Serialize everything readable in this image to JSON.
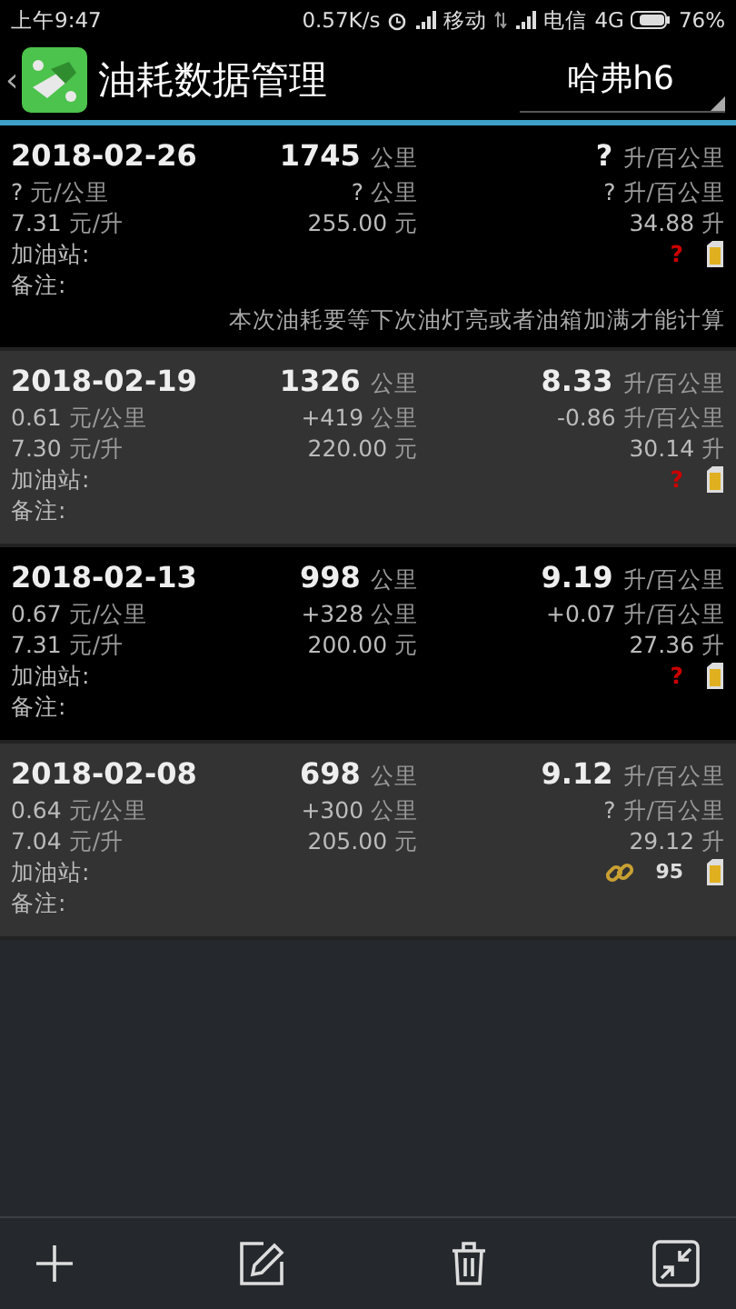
{
  "status_bar": {
    "time": "上午9:47",
    "speed": "0.57K/s",
    "carrier_1": "移动",
    "carrier_2": "电信",
    "network": "4G",
    "battery": "76%"
  },
  "header": {
    "title": "油耗数据管理",
    "back": "‹",
    "vehicle": "哈弗h6"
  },
  "records": [
    {
      "date": "2018-02-26",
      "odometer": {
        "value": "1745",
        "unit": "公里"
      },
      "consumption": {
        "value": "?",
        "unit": "升/百公里"
      },
      "cost_per_km": {
        "value": "?",
        "unit": "元/公里"
      },
      "distance": {
        "value": "?",
        "unit": "公里"
      },
      "consumption_change": {
        "value": "?",
        "unit": "升/百公里"
      },
      "price": {
        "value": "7.31",
        "unit": "元/升"
      },
      "amount": {
        "value": "255.00",
        "unit": "元"
      },
      "volume": {
        "value": "34.88",
        "unit": "升"
      },
      "station_label": "加油站:",
      "notes_label": "备注:",
      "marker": {
        "kind": "question",
        "text": "?"
      },
      "note": "本次油耗要等下次油灯亮或者油箱加满才能计算"
    },
    {
      "date": "2018-02-19",
      "odometer": {
        "value": "1326",
        "unit": "公里"
      },
      "consumption": {
        "value": "8.33",
        "unit": "升/百公里"
      },
      "cost_per_km": {
        "value": "0.61",
        "unit": "元/公里"
      },
      "distance": {
        "value": "+419",
        "unit": "公里"
      },
      "consumption_change": {
        "value": "-0.86",
        "unit": "升/百公里"
      },
      "price": {
        "value": "7.30",
        "unit": "元/升"
      },
      "amount": {
        "value": "220.00",
        "unit": "元"
      },
      "volume": {
        "value": "30.14",
        "unit": "升"
      },
      "station_label": "加油站:",
      "notes_label": "备注:",
      "marker": {
        "kind": "question",
        "text": "?"
      }
    },
    {
      "date": "2018-02-13",
      "odometer": {
        "value": "998",
        "unit": "公里"
      },
      "consumption": {
        "value": "9.19",
        "unit": "升/百公里"
      },
      "cost_per_km": {
        "value": "0.67",
        "unit": "元/公里"
      },
      "distance": {
        "value": "+328",
        "unit": "公里"
      },
      "consumption_change": {
        "value": "+0.07",
        "unit": "升/百公里"
      },
      "price": {
        "value": "7.31",
        "unit": "元/升"
      },
      "amount": {
        "value": "200.00",
        "unit": "元"
      },
      "volume": {
        "value": "27.36",
        "unit": "升"
      },
      "station_label": "加油站:",
      "notes_label": "备注:",
      "marker": {
        "kind": "question",
        "text": "?"
      }
    },
    {
      "date": "2018-02-08",
      "odometer": {
        "value": "698",
        "unit": "公里"
      },
      "consumption": {
        "value": "9.12",
        "unit": "升/百公里"
      },
      "cost_per_km": {
        "value": "0.64",
        "unit": "元/公里"
      },
      "distance": {
        "value": "+300",
        "unit": "公里"
      },
      "consumption_change": {
        "value": "?",
        "unit": "升/百公里"
      },
      "price": {
        "value": "7.04",
        "unit": "元/升"
      },
      "amount": {
        "value": "205.00",
        "unit": "元"
      },
      "volume": {
        "value": "29.12",
        "unit": "升"
      },
      "station_label": "加油站:",
      "notes_label": "备注:",
      "marker": {
        "kind": "link"
      },
      "grade": "95"
    }
  ],
  "toolbar": [
    {
      "kind": "add"
    },
    {
      "kind": "edit"
    },
    {
      "kind": "delete"
    },
    {
      "kind": "collapse"
    }
  ]
}
